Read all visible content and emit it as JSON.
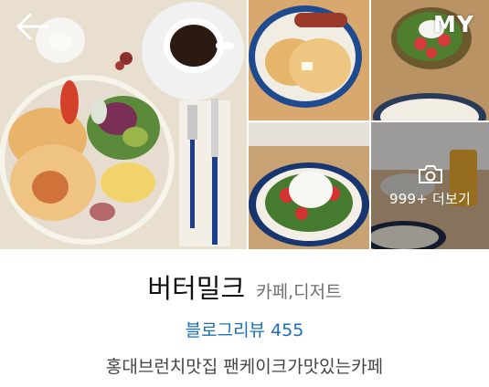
{
  "header": {
    "back_icon": "arrow-left-icon",
    "my_label": "MY"
  },
  "gallery": {
    "more_icon": "camera-icon",
    "more_label": "999+ 더보기"
  },
  "place": {
    "name": "버터밀크",
    "category": "카페,디저트",
    "review_label": "블로그리뷰 455",
    "description": "홍대브런치맛집 팬케이크가맛있는카페"
  },
  "colors": {
    "link_blue": "#1e6fb8",
    "category_gray": "#6f6f6f"
  }
}
